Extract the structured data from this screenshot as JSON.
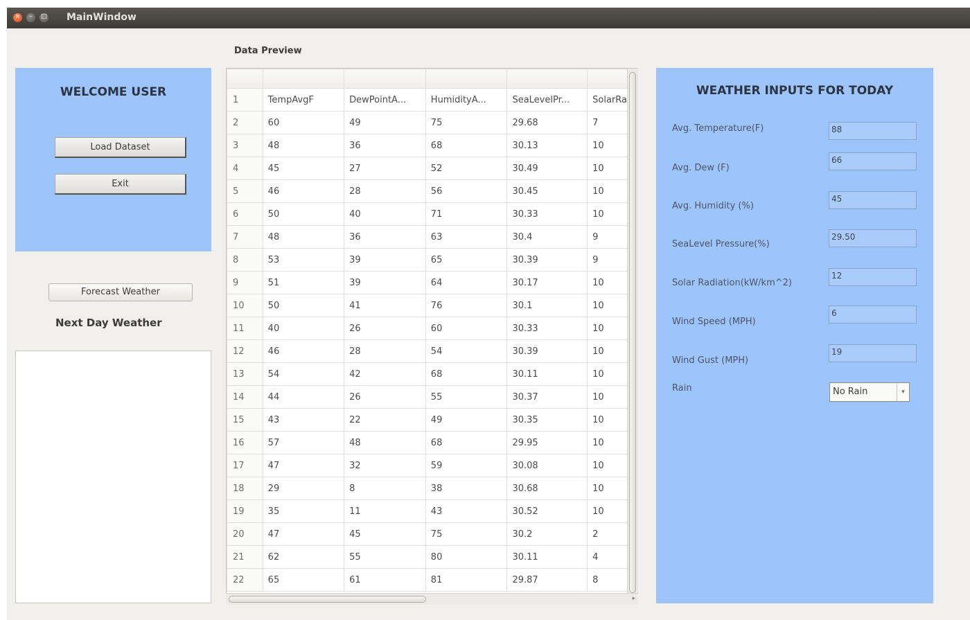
{
  "window": {
    "title": "MainWindow"
  },
  "left": {
    "welcome": "WELCOME USER",
    "load_button": "Load Dataset",
    "exit_button": "Exit",
    "forecast_button": "Forecast Weather",
    "next_day_label": "Next Day Weather"
  },
  "preview": {
    "label": "Data Preview",
    "header_row": [
      "",
      "",
      "",
      "",
      "",
      ""
    ],
    "rows": [
      [
        "1",
        "TempAvgF",
        "DewPointA...",
        "HumidityA...",
        "SeaLevelPr...",
        "SolarRa"
      ],
      [
        "2",
        "60",
        "49",
        "75",
        "29.68",
        "7"
      ],
      [
        "3",
        "48",
        "36",
        "68",
        "30.13",
        "10"
      ],
      [
        "4",
        "45",
        "27",
        "52",
        "30.49",
        "10"
      ],
      [
        "5",
        "46",
        "28",
        "56",
        "30.45",
        "10"
      ],
      [
        "6",
        "50",
        "40",
        "71",
        "30.33",
        "10"
      ],
      [
        "7",
        "48",
        "36",
        "63",
        "30.4",
        "9"
      ],
      [
        "8",
        "53",
        "39",
        "65",
        "30.39",
        "9"
      ],
      [
        "9",
        "51",
        "39",
        "64",
        "30.17",
        "10"
      ],
      [
        "10",
        "50",
        "41",
        "76",
        "30.1",
        "10"
      ],
      [
        "11",
        "40",
        "26",
        "60",
        "30.33",
        "10"
      ],
      [
        "12",
        "46",
        "28",
        "54",
        "30.39",
        "10"
      ],
      [
        "13",
        "54",
        "42",
        "68",
        "30.11",
        "10"
      ],
      [
        "14",
        "44",
        "26",
        "55",
        "30.37",
        "10"
      ],
      [
        "15",
        "43",
        "22",
        "49",
        "30.35",
        "10"
      ],
      [
        "16",
        "57",
        "48",
        "68",
        "29.95",
        "10"
      ],
      [
        "17",
        "47",
        "32",
        "59",
        "30.08",
        "10"
      ],
      [
        "18",
        "29",
        "8",
        "38",
        "30.68",
        "10"
      ],
      [
        "19",
        "35",
        "11",
        "43",
        "30.52",
        "10"
      ],
      [
        "20",
        "47",
        "45",
        "75",
        "30.2",
        "2"
      ],
      [
        "21",
        "62",
        "55",
        "80",
        "30.11",
        "4"
      ],
      [
        "22",
        "65",
        "61",
        "81",
        "29.87",
        "8"
      ]
    ]
  },
  "inputs": {
    "title": "WEATHER INPUTS FOR TODAY",
    "fields": [
      {
        "label": "Avg. Temperature(F)",
        "value": "88"
      },
      {
        "label": "Avg. Dew (F)",
        "value": "66"
      },
      {
        "label": "Avg. Humidity (%)",
        "value": "45"
      },
      {
        "label": "SeaLevel Pressure(%)",
        "value": "29.50"
      },
      {
        "label": "Solar Radiation(kW/km^2)",
        "value": "12"
      },
      {
        "label": "Wind Speed (MPH)",
        "value": "6"
      },
      {
        "label": "Wind Gust (MPH)",
        "value": "19"
      }
    ],
    "rain_label": "Rain",
    "rain_selected": "No Rain"
  },
  "colors": {
    "panel_blue": "#9dc4fb",
    "input_blue": "#a9ccfc",
    "titlebar": "#3c3b37",
    "close_button": "#d94d22"
  }
}
